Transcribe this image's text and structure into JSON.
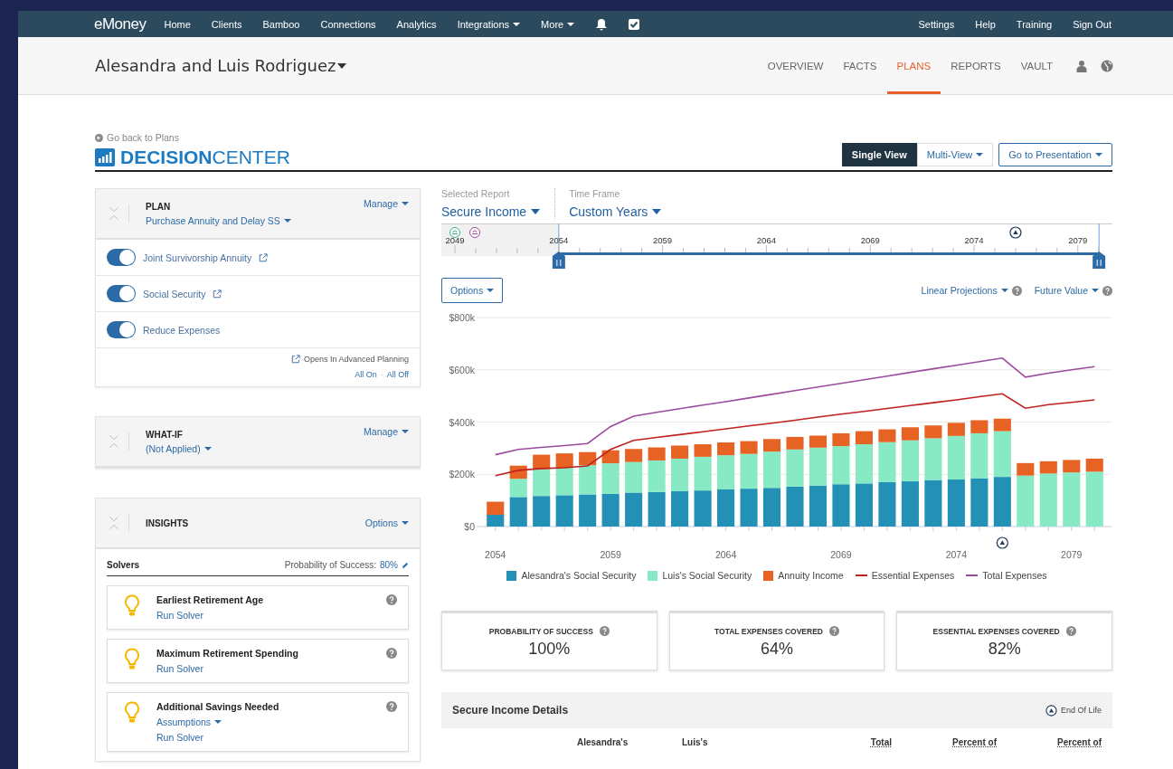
{
  "top_nav": {
    "logo": "eMoney",
    "items": [
      {
        "label": "Home",
        "dropdown": false
      },
      {
        "label": "Clients",
        "dropdown": false
      },
      {
        "label": "Bamboo",
        "dropdown": false
      },
      {
        "label": "Connections",
        "dropdown": false
      },
      {
        "label": "Analytics",
        "dropdown": false
      },
      {
        "label": "Integrations",
        "dropdown": true
      },
      {
        "label": "More",
        "dropdown": true
      }
    ],
    "right_items": [
      "Settings",
      "Help",
      "Training",
      "Sign Out"
    ]
  },
  "client_header": {
    "name": "Alesandra and Luis Rodriguez",
    "tabs": [
      {
        "label": "OVERVIEW",
        "selected": false
      },
      {
        "label": "FACTS",
        "selected": false
      },
      {
        "label": "PLANS",
        "selected": true
      },
      {
        "label": "REPORTS",
        "selected": false
      },
      {
        "label": "VAULT",
        "selected": false
      }
    ]
  },
  "page": {
    "back_link": "Go back to Plans",
    "title": "**DECISION**CENTER",
    "view_buttons": [
      {
        "label": "Single View",
        "selected": true,
        "dropdown": false
      },
      {
        "label": "Multi-View",
        "selected": false,
        "dropdown": true
      }
    ],
    "presentation_button": "Go to Presentation"
  },
  "plan_panel": {
    "heading": "PLAN",
    "value": "Purchase Annuity and Delay SS",
    "manage": "Manage",
    "toggles": [
      {
        "label": "Joint Survivorship Annuity",
        "on": true,
        "external": true
      },
      {
        "label": "Social Security",
        "on": true,
        "external": true
      },
      {
        "label": "Reduce Expenses",
        "on": true,
        "external": false
      }
    ],
    "note": "Opens In Advanced Planning",
    "all_on": "All On",
    "separator": "·",
    "all_off": "All Off"
  },
  "what_if_panel": {
    "heading": "WHAT-IF",
    "value": "(Not Applied)",
    "manage": "Manage"
  },
  "insights_panel": {
    "heading": "INSIGHTS",
    "options": "Options",
    "solvers_label": "Solvers",
    "probability_label": "Probability of Success:",
    "probability_value": "80%",
    "solvers": [
      {
        "title": "Earliest Retirement Age",
        "action": "Run Solver"
      },
      {
        "title": "Maximum Retirement Spending",
        "action": "Run Solver"
      },
      {
        "title": "Additional Savings Needed",
        "assumptions": "Assumptions",
        "action": "Run Solver"
      }
    ]
  },
  "report_bar": {
    "report_label": "Selected Report",
    "report_value": "Secure Income",
    "time_label": "Time Frame",
    "time_value": "Custom Years"
  },
  "timeline": {
    "ticks": [
      "2049",
      "2054",
      "2059",
      "2064",
      "2069",
      "2074",
      "2079"
    ],
    "handles": [
      {
        "level": 0.175
      },
      {
        "level": 0.98
      }
    ]
  },
  "chart_controls": {
    "options": "Options",
    "projection": "Linear Projections",
    "value_mode": "Future Value"
  },
  "chart": {
    "chart_data": {
      "type": "bar",
      "stacked": true,
      "x": [
        2054,
        2055,
        2056,
        2057,
        2058,
        2059,
        2060,
        2061,
        2062,
        2063,
        2064,
        2065,
        2066,
        2067,
        2068,
        2069,
        2070,
        2071,
        2072,
        2073,
        2074,
        2075,
        2076,
        2077,
        2078,
        2079,
        2080
      ],
      "xticks": [
        2054,
        2059,
        2064,
        2069,
        2074,
        2079
      ],
      "xlim": [
        2053.5,
        2080.5
      ],
      "grid": true,
      "ylim": [
        0,
        800
      ],
      "yticks": [
        {
          "value": 0,
          "label": "$0"
        },
        {
          "value": 200,
          "label": "$200k"
        },
        {
          "value": 400,
          "label": "$400k"
        },
        {
          "value": 600,
          "label": "$600k"
        },
        {
          "value": 800,
          "label": "$800k"
        }
      ],
      "series": [
        {
          "name": "Alesandra's Social Security",
          "color": "#2391b5",
          "values": [
            45,
            113,
            117,
            120,
            123,
            125,
            130,
            132,
            135,
            138,
            142,
            145,
            148,
            153,
            157,
            162,
            165,
            170,
            173,
            178,
            180,
            185,
            190,
            0,
            0,
            0,
            0
          ]
        },
        {
          "name": "Luis's Social Security",
          "color": "#87eac5",
          "values": [
            0,
            70,
            103,
            105,
            112,
            117,
            117,
            121,
            125,
            129,
            131,
            133,
            139,
            142,
            145,
            146,
            150,
            153,
            157,
            160,
            167,
            172,
            175,
            195,
            203,
            207,
            210
          ]
        },
        {
          "name": "Annuity Income",
          "color": "#e66323",
          "values": [
            50,
            50,
            55,
            55,
            50,
            50,
            50,
            50,
            50,
            48,
            49,
            49,
            48,
            48,
            46,
            49,
            50,
            49,
            50,
            49,
            50,
            50,
            48,
            48,
            47,
            48,
            50
          ]
        },
        {
          "name": "Essential Expenses",
          "color": "#c0201f",
          "type": "line",
          "values": [
            195,
            215,
            222,
            225,
            232,
            295,
            330,
            341,
            352,
            363,
            374,
            385,
            396,
            407,
            419,
            430,
            441,
            452,
            463,
            474,
            485,
            497,
            508,
            453,
            467,
            475,
            485
          ]
        },
        {
          "name": "Total Expenses",
          "color": "#9b4b9e",
          "type": "line",
          "values": [
            275,
            295,
            303,
            310,
            318,
            383,
            423,
            437,
            451,
            465,
            478,
            492,
            506,
            520,
            534,
            548,
            562,
            576,
            590,
            604,
            617,
            631,
            645,
            572,
            587,
            600,
            612
          ]
        }
      ]
    }
  },
  "stat_cards": [
    {
      "label": "PROBABILITY OF SUCCESS",
      "value": "100%"
    },
    {
      "label": "TOTAL EXPENSES COVERED",
      "value": "64%"
    },
    {
      "label": "ESSENTIAL EXPENSES COVERED",
      "value": "82%"
    }
  ],
  "details": {
    "title": "Secure Income Details",
    "legend": "End Of Life",
    "columns": [
      {
        "label": "Alesandra's",
        "dotted": false
      },
      {
        "label": "Luis's",
        "dotted": false
      },
      {
        "label": "Total",
        "dotted": true
      },
      {
        "label": "Percent of",
        "dotted": true
      },
      {
        "label": "Percent of",
        "dotted": true
      }
    ]
  }
}
